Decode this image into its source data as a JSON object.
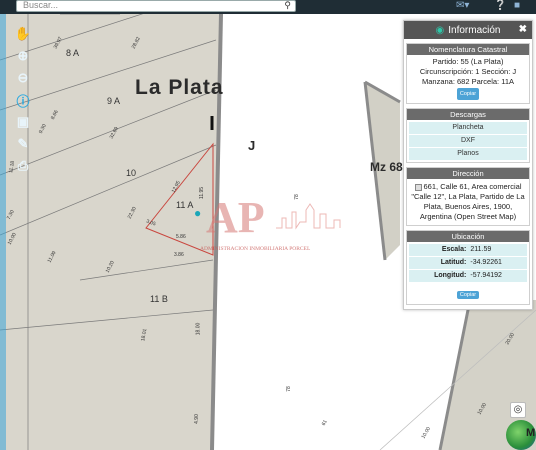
{
  "search": {
    "placeholder": "Buscar..."
  },
  "top_icons": [
    "mail-icon",
    "help-icon",
    "user-icon"
  ],
  "map": {
    "city_label": "La Plata",
    "zone_letter": "J",
    "manzana_label": "Mz 68",
    "blocks": [
      "8 A",
      "9 A",
      "10",
      "11 A",
      "11 B"
    ],
    "measures": [
      "39.97",
      "28.82",
      "32.69",
      "8.66",
      "9.30",
      "11.18",
      "7.30",
      "10.00",
      "22.30",
      "12.95",
      "11.95",
      "3.05",
      "5.86",
      "3.86",
      "11.09",
      "10.20",
      "18.01",
      "18.00",
      "4.90",
      "78",
      "78",
      "61",
      "20.00",
      "10.00",
      "10.00"
    ],
    "watermark_text": "ADMINISTRACION INMOBILIARIA PORCEL",
    "watermark_logo": "AP"
  },
  "toolbar": [
    "hand-icon",
    "zoom-in-icon",
    "zoom-out-icon",
    "info-icon",
    "layers-icon",
    "measure-icon",
    "print-icon"
  ],
  "panel": {
    "title": "Información",
    "sections": {
      "catastral": {
        "heading": "Nomenclatura Catastral",
        "line1": "Partido: 55 (La Plata)",
        "line2": "Circunscripción: 1 Sección: J",
        "line3": "Manzana: 682 Parcela: 11A",
        "copy": "Copiar"
      },
      "descargas": {
        "heading": "Descargas",
        "items": [
          "Plancheta",
          "DXF",
          "Planos"
        ]
      },
      "direccion": {
        "heading": "Dirección",
        "text": "661, Calle 61, Area comercial \"Calle 12\", La Plata, Partido de La Plata, Buenos Aires, 1900, Argentina (Open Street Map)"
      },
      "ubicacion": {
        "heading": "Ubicación",
        "escala_k": "Escala:",
        "escala_v": "211.59",
        "lat_k": "Latitud:",
        "lat_v": "-34.92261",
        "lon_k": "Longitud:",
        "lon_v": "-57.94192",
        "copy": "Copiar"
      }
    }
  }
}
